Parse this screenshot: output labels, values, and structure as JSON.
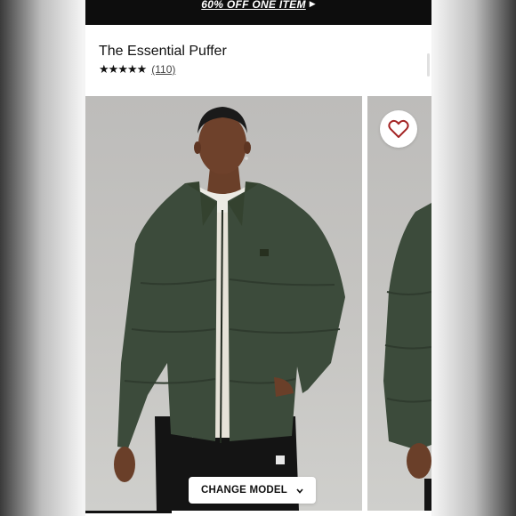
{
  "promo": {
    "text": "60% OFF ONE ITEM",
    "arrow_icon": "triangle-right-icon"
  },
  "product": {
    "title": "The Essential Puffer",
    "rating": {
      "stars": 5,
      "max_stars": 5,
      "review_count": "(110)"
    }
  },
  "gallery": {
    "favorite_icon": "heart-outline-icon",
    "change_model_label": "CHANGE MODEL",
    "chevron_icon": "chevron-down-icon",
    "progress": 0.25
  },
  "colors": {
    "promo_bg": "#0d0d0d",
    "jacket_green": "#3c4b3b",
    "heart_red": "#a32424",
    "text": "#111111"
  }
}
